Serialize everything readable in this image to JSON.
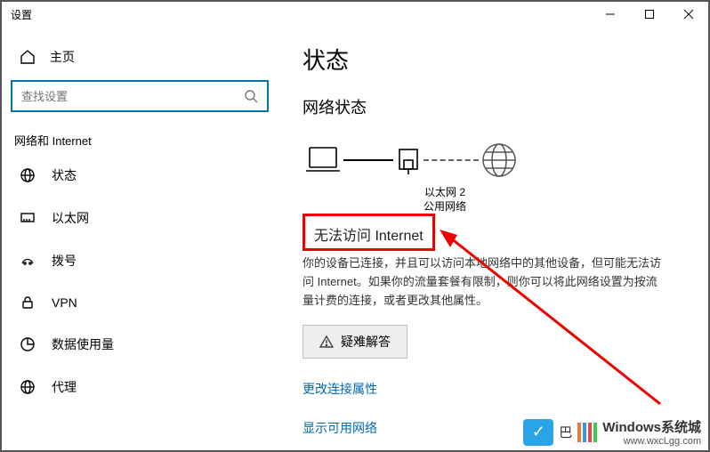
{
  "window": {
    "title": "设置"
  },
  "home_label": "主页",
  "search": {
    "placeholder": "查找设置"
  },
  "category": "网络和 Internet",
  "nav": [
    {
      "label": "状态"
    },
    {
      "label": "以太网"
    },
    {
      "label": "拨号"
    },
    {
      "label": "VPN"
    },
    {
      "label": "数据使用量"
    },
    {
      "label": "代理"
    }
  ],
  "page_title": "状态",
  "section_title": "网络状态",
  "adapter": {
    "name": "以太网 2",
    "profile": "公用网络"
  },
  "status_line": "无法访问 Internet",
  "description": "你的设备已连接，并且可以访问本地网络中的其他设备，但可能无法访问 Internet。如果你的流量套餐有限制，则你可以将此网络设置为按流量计费的连接，或者更改其他属性。",
  "troubleshoot": "疑难解答",
  "link_change": "更改连接属性",
  "link_show": "显示可用网络",
  "watermark": {
    "brand": "Windows系统城",
    "url": "www.wxcLgg.com",
    "letter": "巴"
  }
}
